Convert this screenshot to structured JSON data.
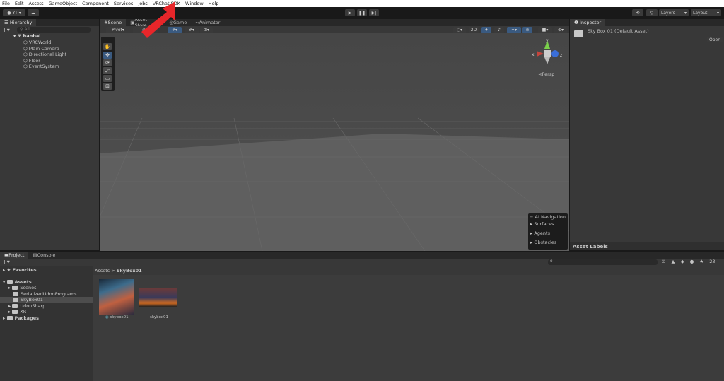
{
  "menu": [
    "File",
    "Edit",
    "Assets",
    "GameObject",
    "Component",
    "Services",
    "Jobs",
    "VRChat SDK",
    "Window",
    "Help"
  ],
  "toolbar": {
    "account": "YT",
    "layers": "Layers",
    "layout": "Layout"
  },
  "hierarchy": {
    "title": "Hierarchy",
    "search_placeholder": "All",
    "scene": "hanbai",
    "items": [
      "VRCWorld",
      "Main Camera",
      "Directional Light",
      "Floor",
      "EventSystem"
    ]
  },
  "scene_tabs": [
    "Scene",
    "Asset Store",
    "Game",
    "Animator"
  ],
  "scene_toolbar": {
    "pivot": "Pivot",
    "mode2d": "2D"
  },
  "gizmo": {
    "x": "x",
    "y": "y",
    "z": "z",
    "persp": "Persp"
  },
  "ai_nav": {
    "title": "AI Navigation",
    "items": [
      "Surfaces",
      "Agents",
      "Obstacles"
    ]
  },
  "inspector": {
    "title": "Inspector",
    "asset": "Sky Box 01 (Default Asset)",
    "open": "Open",
    "labels": "Asset Labels"
  },
  "project": {
    "tabs": [
      "Project",
      "Console"
    ],
    "favorites": "Favorites",
    "assets": "Assets",
    "folders": [
      "Scenes",
      "SerializedUdonPrograms",
      "SkyBox01",
      "UdonSharp",
      "XR"
    ],
    "packages": "Packages",
    "breadcrumb": [
      "Assets",
      "SkyBox01"
    ],
    "files": [
      "skybox01",
      "skybox01"
    ],
    "hidden_count": "23"
  },
  "colors": {
    "accent": "#3a5a80",
    "arrow": "#e8262a"
  }
}
